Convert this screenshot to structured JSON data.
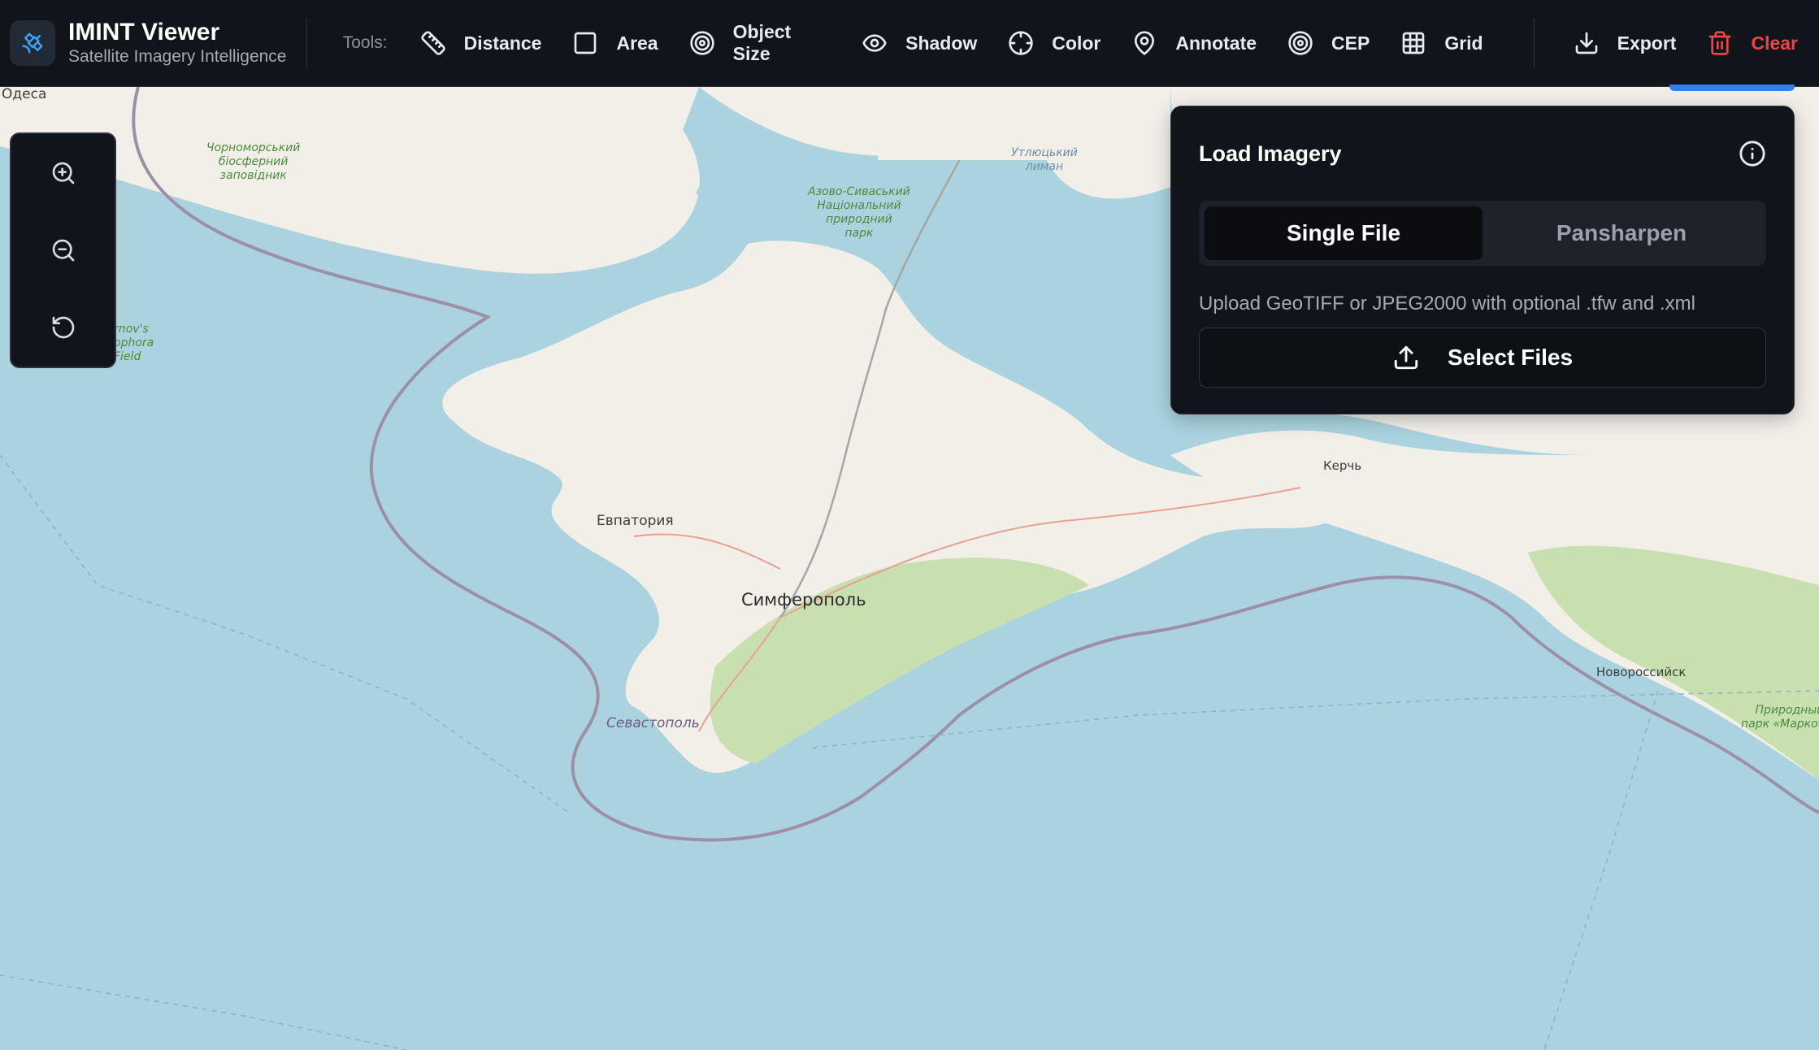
{
  "app": {
    "title": "IMINT Viewer",
    "subtitle": "Satellite Imagery Intelligence"
  },
  "toolbar": {
    "tools_label": "Tools:",
    "tools": [
      {
        "label": "Distance",
        "icon": "ruler-icon"
      },
      {
        "label": "Area",
        "icon": "square-icon"
      },
      {
        "label": "Object Size",
        "icon": "target-icon"
      },
      {
        "label": "Shadow",
        "icon": "eye-icon"
      },
      {
        "label": "Color",
        "icon": "crosshair-icon"
      },
      {
        "label": "Annotate",
        "icon": "map-pin-icon"
      },
      {
        "label": "CEP",
        "icon": "concentric-circle-icon"
      },
      {
        "label": "Grid",
        "icon": "grid-icon"
      }
    ],
    "export_label": "Export",
    "clear_label": "Clear"
  },
  "zoom_controls": {
    "zoom_in_icon": "zoom-in-icon",
    "zoom_out_icon": "zoom-out-icon",
    "reset_icon": "reset-rotate-icon"
  },
  "load_panel": {
    "title": "Load Imagery",
    "tabs": [
      {
        "label": "Single File",
        "active": true
      },
      {
        "label": "Pansharpen",
        "active": false
      }
    ],
    "description": "Upload GeoTIFF or JPEG2000 with optional .tfw and .xml",
    "select_button": "Select Files"
  },
  "map": {
    "labels": {
      "odesa": "Одеса",
      "chornomorskyi": [
        "Чорноморський",
        "біосферний",
        "заповідник"
      ],
      "azovo_syvaskyi": [
        "Азово-Сиваський",
        "Національний",
        "природний",
        "парк"
      ],
      "utliutskyi": [
        "Утлюцький",
        "лиман"
      ],
      "chernovs": [
        "rnov's",
        "ophora",
        "Field"
      ],
      "yevpatoriya": "Евпатория",
      "simferopol": "Симферополь",
      "sevastopol": "Севастополь",
      "kerch": "Керчь",
      "novorossiysk": "Новороссийск",
      "markotkh": [
        "Природный",
        "парк «Маркотх»"
      ]
    },
    "colors": {
      "water": "#aad3df",
      "land": "#f2efe9",
      "forest": "#c8dfb0",
      "boundary": "#9d8fa8"
    }
  }
}
